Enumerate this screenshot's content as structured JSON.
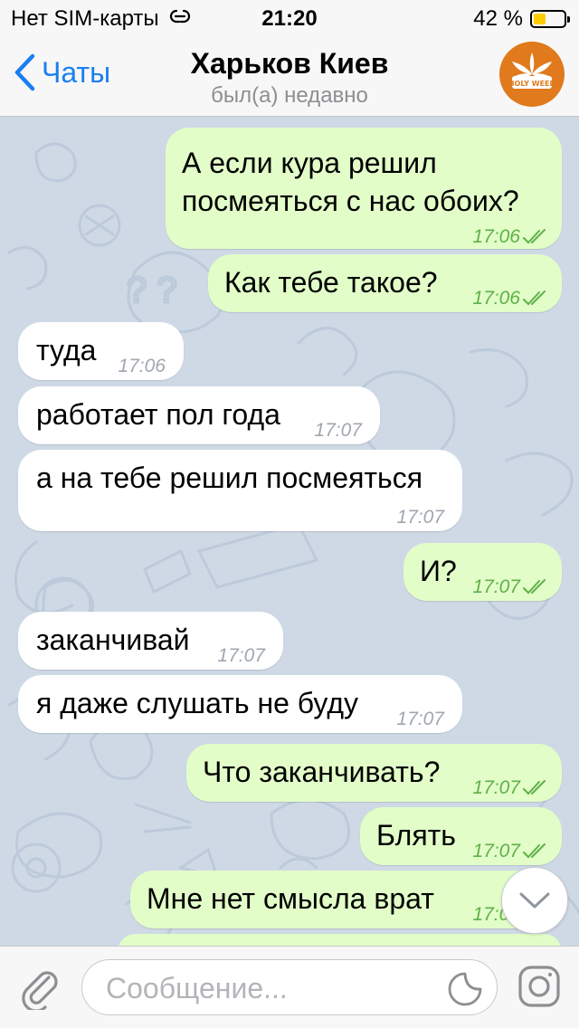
{
  "status_bar": {
    "carrier": "Нет SIM-карты",
    "time": "21:20",
    "battery": "42 %",
    "battery_level": 0.42
  },
  "header": {
    "back_label": "Чаты",
    "title": "Харьков Киев",
    "subtitle": "был(а) недавно",
    "avatar_text": "HOLY WEED"
  },
  "messages": [
    {
      "dir": "out",
      "text1": "А если кура решил",
      "text2": "посмеяться с нас обоих?",
      "time": "17:06"
    },
    {
      "dir": "out",
      "text": "Как тебе такое?",
      "time": "17:06"
    },
    {
      "dir": "in",
      "text": "туда",
      "time": "17:06"
    },
    {
      "dir": "in",
      "text": "работает пол года",
      "time": "17:07"
    },
    {
      "dir": "in",
      "text": "а на тебе решил посмеяться",
      "time": "17:07"
    },
    {
      "dir": "out",
      "text": "И?",
      "time": "17:07"
    },
    {
      "dir": "in",
      "text": "заканчивай",
      "time": "17:07"
    },
    {
      "dir": "in",
      "text": "я даже слушать не буду",
      "time": "17:07"
    },
    {
      "dir": "out",
      "text": "Что заканчивать?",
      "time": "17:07"
    },
    {
      "dir": "out",
      "text": "Блять",
      "time": "17:07"
    },
    {
      "dir": "out",
      "text": "Мне нет смысла врат",
      "time": "17:07"
    }
  ],
  "input": {
    "placeholder": "Сообщение..."
  },
  "icons": {
    "back": "chevron-left-icon",
    "attach": "paperclip-icon",
    "sticker": "sticker-icon",
    "camera": "camera-icon",
    "scroll": "chevron-down-icon",
    "read": "double-check-icon",
    "sim": "link-icon"
  },
  "colors": {
    "accent": "#1a7ff0",
    "outgoing_bubble": "#e2fdc8",
    "incoming_bubble": "#ffffff",
    "chat_background": "#cfd9e6",
    "outgoing_time": "#5fb14a"
  }
}
